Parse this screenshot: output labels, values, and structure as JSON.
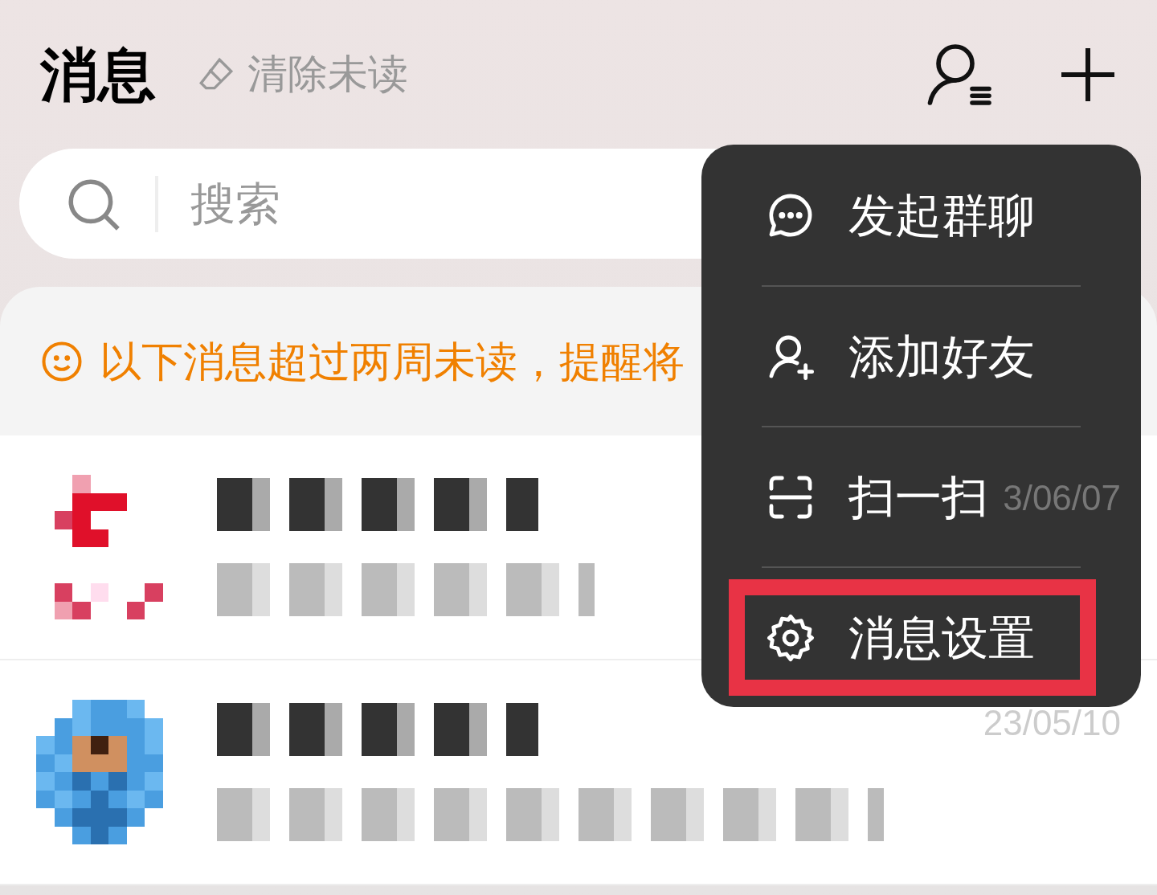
{
  "header": {
    "title": "消息",
    "clear_unread": "清除未读"
  },
  "search": {
    "placeholder": "搜索"
  },
  "notice": {
    "text": "以下消息超过两周未读，提醒将"
  },
  "chats": [
    {
      "date": "3/06/07"
    },
    {
      "date": "23/05/10"
    }
  ],
  "menu": {
    "items": [
      {
        "kind": "group-chat",
        "label": "发起群聊",
        "highlighted": false
      },
      {
        "kind": "add-friend",
        "label": "添加好友",
        "highlighted": false
      },
      {
        "kind": "scan",
        "label": "扫一扫",
        "highlighted": false
      },
      {
        "kind": "settings",
        "label": "消息设置",
        "highlighted": true
      }
    ]
  }
}
